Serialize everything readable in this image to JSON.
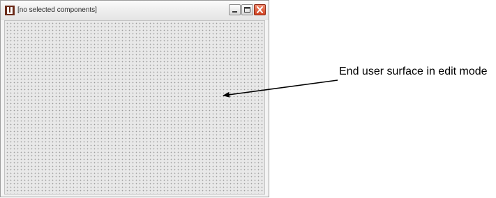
{
  "window": {
    "title": "[no selected components]",
    "icon": "app-logo-icon",
    "buttons": {
      "minimize_icon": "minimize-icon",
      "maximize_icon": "maximize-icon",
      "close_icon": "close-icon"
    }
  },
  "surface": {
    "mode": "edit",
    "pattern": "dotted-grid",
    "background_color": "#e8e8e8"
  },
  "annotation": {
    "label": "End user surface in edit mode"
  },
  "colors": {
    "close_button": "#d0401e",
    "app_icon": "#6b2a18"
  }
}
